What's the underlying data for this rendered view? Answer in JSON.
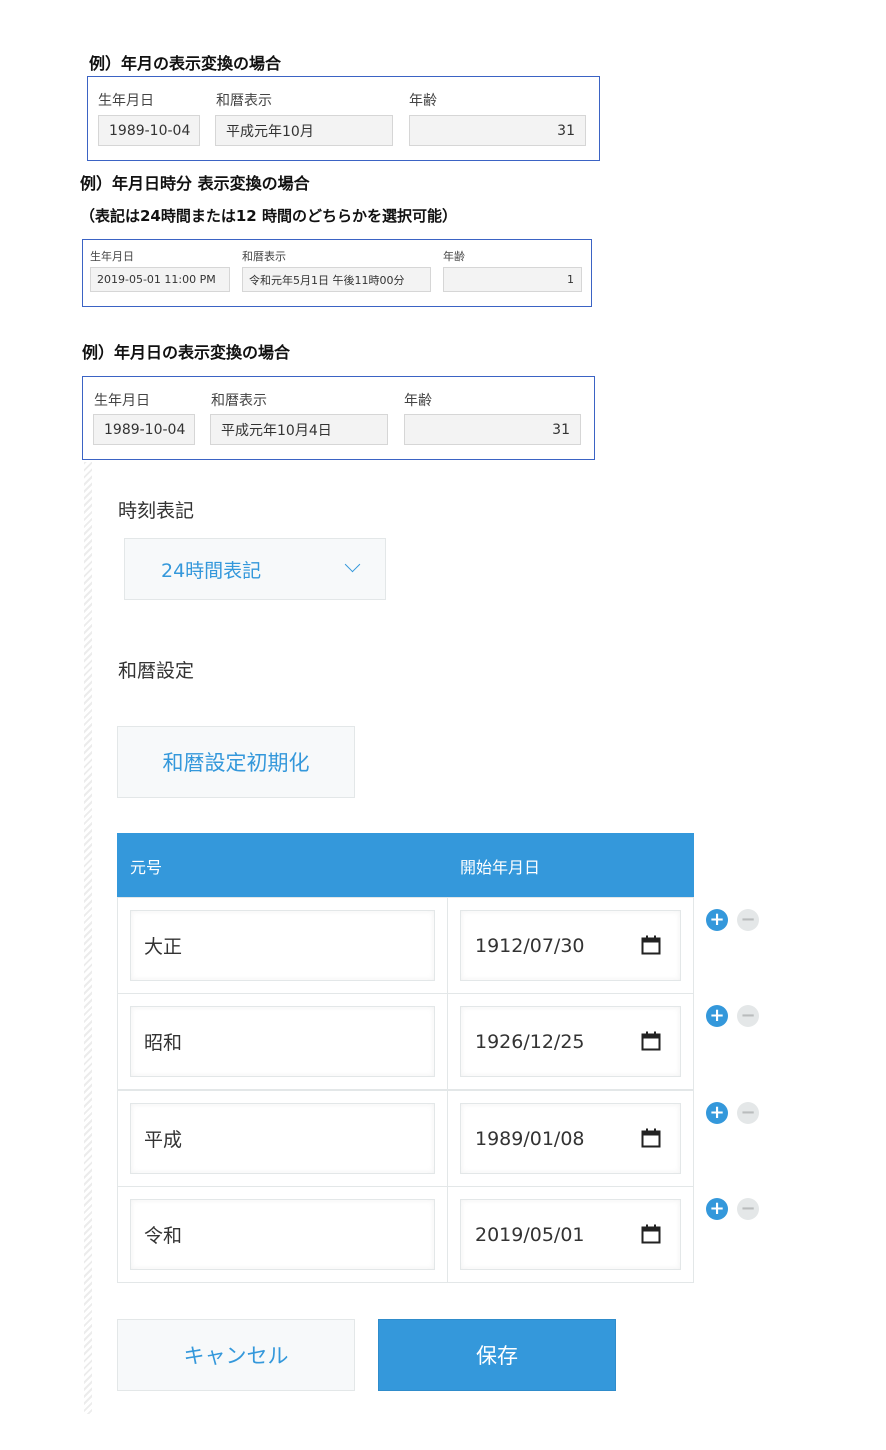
{
  "examples": {
    "ym": {
      "heading": "例）年月の表示変換の場合",
      "labels": {
        "birth": "生年月日",
        "wareki": "和暦表示",
        "age": "年齢"
      },
      "values": {
        "birth": "1989-10-04",
        "wareki": "平成元年10月",
        "age": "31"
      }
    },
    "ymdhm": {
      "heading": "例）年月日時分 表示変換の場合",
      "subheading": "（表記は24時間または12 時間のどちらかを選択可能）",
      "labels": {
        "birth": "生年月日",
        "wareki": "和暦表示",
        "age": "年齢"
      },
      "values": {
        "birth": "2019-05-01 11:00 PM",
        "wareki": "令和元年5月1日 午後11時00分",
        "age": "1"
      }
    },
    "ymd": {
      "heading": "例）年月日の表示変換の場合",
      "labels": {
        "birth": "生年月日",
        "wareki": "和暦表示",
        "age": "年齢"
      },
      "values": {
        "birth": "1989-10-04",
        "wareki": "平成元年10月4日",
        "age": "31"
      }
    }
  },
  "settings": {
    "time_format": {
      "label": "時刻表記",
      "selected": "24時間表記",
      "icon": "chevron-down-icon"
    },
    "era": {
      "label": "和暦設定",
      "reset_button": "和暦設定初期化"
    },
    "table": {
      "headers": {
        "era": "元号",
        "start": "開始年月日"
      },
      "rows": [
        {
          "era": "大正",
          "start": "1912/07/30"
        },
        {
          "era": "昭和",
          "start": "1926/12/25"
        },
        {
          "era": "平成",
          "start": "1989/01/08"
        },
        {
          "era": "令和",
          "start": "2019/05/01"
        }
      ],
      "add_symbol": "+",
      "remove_symbol": "−"
    }
  },
  "actions": {
    "cancel": "キャンセル",
    "save": "保存"
  },
  "colors": {
    "accent": "#3498db",
    "example_border": "#3b63c4",
    "field_bg": "#f3f3f3"
  }
}
